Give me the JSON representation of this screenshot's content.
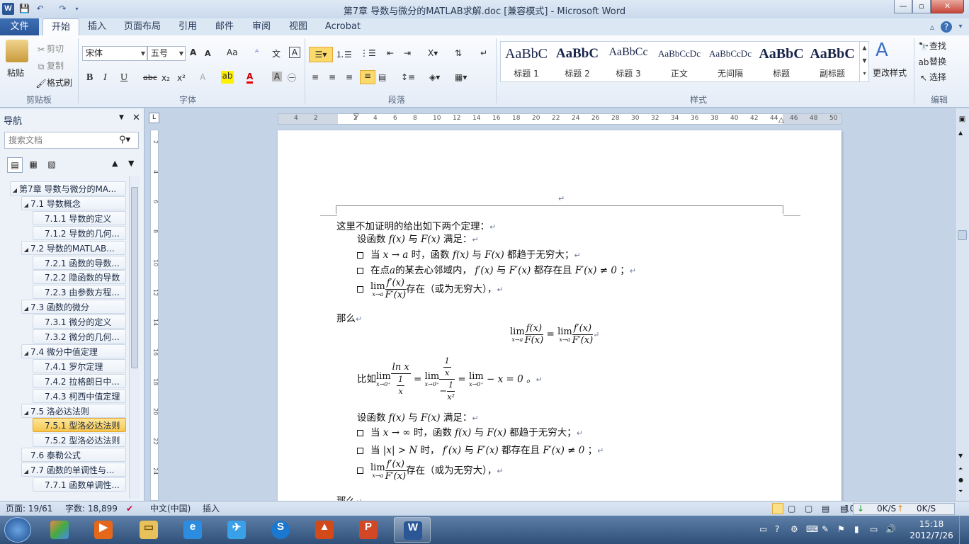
{
  "titlebar": {
    "title": "第7章  导数与微分的MATLAB求解.doc [兼容模式]  -  Microsoft Word",
    "app_icon": "W"
  },
  "tabs": {
    "file": "文件",
    "items": [
      "开始",
      "插入",
      "页面布局",
      "引用",
      "邮件",
      "审阅",
      "视图",
      "Acrobat"
    ],
    "active": "开始"
  },
  "clipboard": {
    "paste": "粘贴",
    "cut": "剪切",
    "copy": "复制",
    "format_painter": "格式刷",
    "label": "剪贴板"
  },
  "font": {
    "family": "宋体",
    "size": "五号",
    "grow": "A",
    "shrink": "A",
    "change_case": "Aa",
    "bold": "B",
    "italic": "I",
    "underline": "U",
    "strike": "abc",
    "subscript": "x₂",
    "superscript": "x²",
    "label": "字体"
  },
  "paragraph": {
    "label": "段落"
  },
  "styles": {
    "label": "样式",
    "items": [
      {
        "sample": "AaBbC",
        "name": "标题 1"
      },
      {
        "sample": "AaBbC",
        "name": "标题 2"
      },
      {
        "sample": "AaBbCc",
        "name": "标题 3"
      },
      {
        "sample": "AaBbCcDc",
        "name": "正文"
      },
      {
        "sample": "AaBbCcDc",
        "name": "无间隔"
      },
      {
        "sample": "AaBbC",
        "name": "标题"
      },
      {
        "sample": "AaBbC",
        "name": "副标题"
      }
    ],
    "change": "更改样式"
  },
  "editing": {
    "find": "查找",
    "replace": "替换",
    "select": "选择",
    "label": "编辑"
  },
  "nav": {
    "title": "导航",
    "search_placeholder": "搜索文档",
    "items": [
      {
        "text": "第7章  导数与微分的MA...",
        "level": 0
      },
      {
        "text": "7.1  导数概念",
        "level": 1
      },
      {
        "text": "7.1.1  导数的定义",
        "level": 2
      },
      {
        "text": "7.1.2  导数的几何...",
        "level": 2
      },
      {
        "text": "7.2  导数的MATLAB...",
        "level": 1
      },
      {
        "text": "7.2.1  函数的导数...",
        "level": 2
      },
      {
        "text": "7.2.2  隐函数的导数",
        "level": 2
      },
      {
        "text": "7.2.3  由参数方程...",
        "level": 2
      },
      {
        "text": "7.3  函数的微分",
        "level": 1
      },
      {
        "text": "7.3.1  微分的定义",
        "level": 2
      },
      {
        "text": "7.3.2  微分的几何...",
        "level": 2
      },
      {
        "text": "7.4  微分中值定理",
        "level": 1
      },
      {
        "text": "7.4.1  罗尔定理",
        "level": 2
      },
      {
        "text": "7.4.2  拉格朗日中...",
        "level": 2
      },
      {
        "text": "7.4.3  柯西中值定理",
        "level": 2
      },
      {
        "text": "7.5  洛必达法则",
        "level": 1
      },
      {
        "text": "7.5.1  型洛必达法则",
        "level": 2,
        "selected": true
      },
      {
        "text": "7.5.2  型洛必达法则",
        "level": 2
      },
      {
        "text": "7.6  泰勒公式",
        "level": 1,
        "leaf": true
      },
      {
        "text": "7.7  函数的单调性与...",
        "level": 1
      },
      {
        "text": "7.7.1  函数单调性...",
        "level": 2
      }
    ]
  },
  "ruler": {
    "ticks": [
      "4",
      "2",
      "",
      "2",
      "4",
      "6",
      "8",
      "10",
      "12",
      "14",
      "16",
      "18",
      "20",
      "22",
      "24",
      "26",
      "28",
      "30",
      "32",
      "34",
      "36",
      "38",
      "40",
      "42",
      "44",
      "46",
      "48",
      "50"
    ],
    "vticks": [
      "2",
      "4",
      "6",
      "8",
      "10",
      "12",
      "14",
      "16",
      "18",
      "20",
      "22",
      "24"
    ]
  },
  "doc": {
    "intro": "这里不加证明的给出如下两个定理：",
    "cond1": "设函数",
    "f": "f(x)",
    "F": "F(x)",
    "and": "与",
    "satisfy": "满足：",
    "b1a": "当",
    "b1x": "x → a",
    "b1b": "时，函数",
    "b1c": "都趋于无穷大；",
    "b2a": "在点",
    "b2m": "a",
    "b2b": "的某去心邻域内，",
    "b2c": "f′(x)",
    "b2d": "与",
    "b2e": "F′(x)",
    "b2f": "都存在且",
    "b2g": "F′(x) ≠ 0",
    "b2h": "；",
    "lim": "lim",
    "sub_a": "x→a",
    "fp": "f′(x)",
    "Fp": "F′(x)",
    "exists": "存在（或为无穷大），",
    "then": "那么",
    "eq": "=",
    "ex_pre": "比如",
    "sub_0": "x→0⁺",
    "lnx": "ln x",
    "one": "1",
    "x": "x",
    "x2": "x²",
    "neg": "−",
    "ex_tail": "− x = 0 。",
    "b4a": "当",
    "b4x": "x → ∞",
    "b4b": "时，函数",
    "b4c": "都趋于无穷大；",
    "b5a": "当",
    "b5x": "|x| > N",
    "b5b": "时，",
    "b5c": "都存在且",
    "b5d": "F′(x) ≠ 0",
    "then2": "那么",
    "mark": "↵"
  },
  "status": {
    "page": "页面: 19/61",
    "words": "字数: 18,899",
    "lang": "中文(中国)",
    "mode": "插入",
    "zoom": "10",
    "down": "0K/S",
    "up": "0K/S"
  },
  "taskbar": {
    "time": "15:18",
    "date": "2012/7/26"
  }
}
